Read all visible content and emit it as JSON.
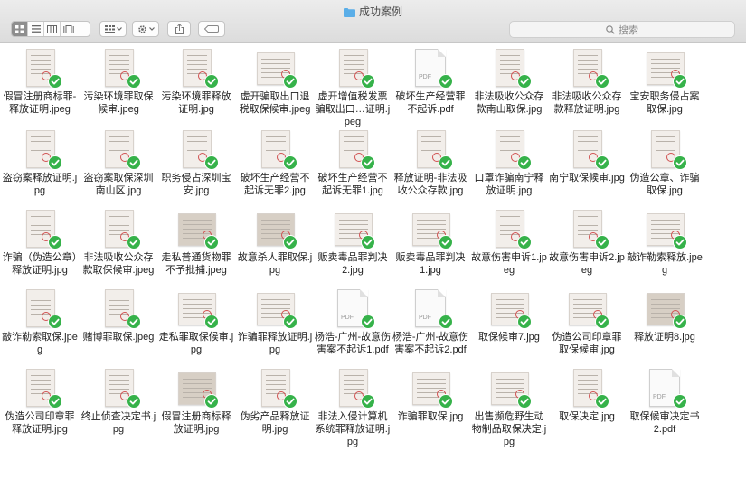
{
  "window": {
    "title": "成功案例"
  },
  "toolbar": {
    "view_buttons": [
      "icon-view-icon",
      "list-view-icon",
      "column-view-icon",
      "gallery-view-icon"
    ],
    "group_menu_icon": "group-grid-icon",
    "action_menu_icon": "gear-icon",
    "share_icon": "share-icon",
    "tag_icon": "tag-icon"
  },
  "search": {
    "placeholder": "搜索",
    "icon": "magnifier-icon"
  },
  "colors": {
    "check": "#36b24a",
    "folder": "#5aaee8",
    "active_view": "#8e8e8e"
  },
  "files": [
    {
      "label": "假冒注册商标罪-释放证明.jpeg",
      "kind": "image"
    },
    {
      "label": "污染环境罪取保候审.jpeg",
      "kind": "image"
    },
    {
      "label": "污染环境罪释放证明.jpg",
      "kind": "image"
    },
    {
      "label": "虚开骗取出口退税取保候审.jpeg",
      "kind": "image"
    },
    {
      "label": "虚开增值税发票骗取出口…证明.jpeg",
      "kind": "image"
    },
    {
      "label": "破坏生产经营罪不起诉.pdf",
      "kind": "pdf"
    },
    {
      "label": "非法吸收公众存款南山取保.jpg",
      "kind": "image"
    },
    {
      "label": "非法吸收公众存款释放证明.jpg",
      "kind": "image"
    },
    {
      "label": "宝安职务侵占案取保.jpg",
      "kind": "image"
    },
    {
      "label": "盗窃案释放证明.jpg",
      "kind": "image"
    },
    {
      "label": "盗窃案取保深圳南山区.jpg",
      "kind": "image"
    },
    {
      "label": "职务侵占深圳宝安.jpg",
      "kind": "image"
    },
    {
      "label": "破坏生产经营不起诉无罪2.jpg",
      "kind": "image"
    },
    {
      "label": "破坏生产经营不起诉无罪1.jpg",
      "kind": "image"
    },
    {
      "label": "释放证明-非法吸收公众存款.jpg",
      "kind": "image"
    },
    {
      "label": "口罩诈骗南宁释放证明.jpg",
      "kind": "image"
    },
    {
      "label": "南宁取保候审.jpg",
      "kind": "image"
    },
    {
      "label": "伪造公章、诈骗取保.jpg",
      "kind": "image"
    },
    {
      "label": "诈骗（伪造公章）释放证明.jpg",
      "kind": "image"
    },
    {
      "label": "非法吸收公众存款取保候审.jpeg",
      "kind": "image"
    },
    {
      "label": "走私普通货物罪不予批捕.jpeg",
      "kind": "image"
    },
    {
      "label": "故意杀人罪取保.jpg",
      "kind": "image"
    },
    {
      "label": "贩卖毒品罪判决2.jpg",
      "kind": "image"
    },
    {
      "label": "贩卖毒品罪判决1.jpg",
      "kind": "image"
    },
    {
      "label": "故意伤害申诉1.jpeg",
      "kind": "image"
    },
    {
      "label": "故意伤害申诉2.jpeg",
      "kind": "image"
    },
    {
      "label": "敲诈勒索释放.jpeg",
      "kind": "image"
    },
    {
      "label": "敲诈勒索取保.jpeg",
      "kind": "image"
    },
    {
      "label": "赌博罪取保.jpeg",
      "kind": "image"
    },
    {
      "label": "走私罪取保候审.jpg",
      "kind": "image"
    },
    {
      "label": "诈骗罪释放证明.jpg",
      "kind": "image"
    },
    {
      "label": "杨浩-广州-故意伤害案不起诉1.pdf",
      "kind": "pdf"
    },
    {
      "label": "杨浩-广州-故意伤害案不起诉2.pdf",
      "kind": "pdf"
    },
    {
      "label": "取保候审7.jpg",
      "kind": "image"
    },
    {
      "label": "伪造公司印章罪取保候审.jpg",
      "kind": "image"
    },
    {
      "label": "释放证明8.jpg",
      "kind": "image"
    },
    {
      "label": "伪造公司印章罪释放证明.jpg",
      "kind": "image"
    },
    {
      "label": "终止侦查决定书.jpg",
      "kind": "image"
    },
    {
      "label": "假冒注册商标释放证明.jpg",
      "kind": "image"
    },
    {
      "label": "伪劣产品释放证明.jpg",
      "kind": "image"
    },
    {
      "label": "非法入侵计算机系统罪释放证明.jpg",
      "kind": "image"
    },
    {
      "label": "诈骗罪取保.jpg",
      "kind": "image"
    },
    {
      "label": "出售濒危野生动物制品取保决定.jpg",
      "kind": "image"
    },
    {
      "label": "取保决定.jpg",
      "kind": "image"
    },
    {
      "label": "取保候审决定书2.pdf",
      "kind": "pdf"
    }
  ]
}
